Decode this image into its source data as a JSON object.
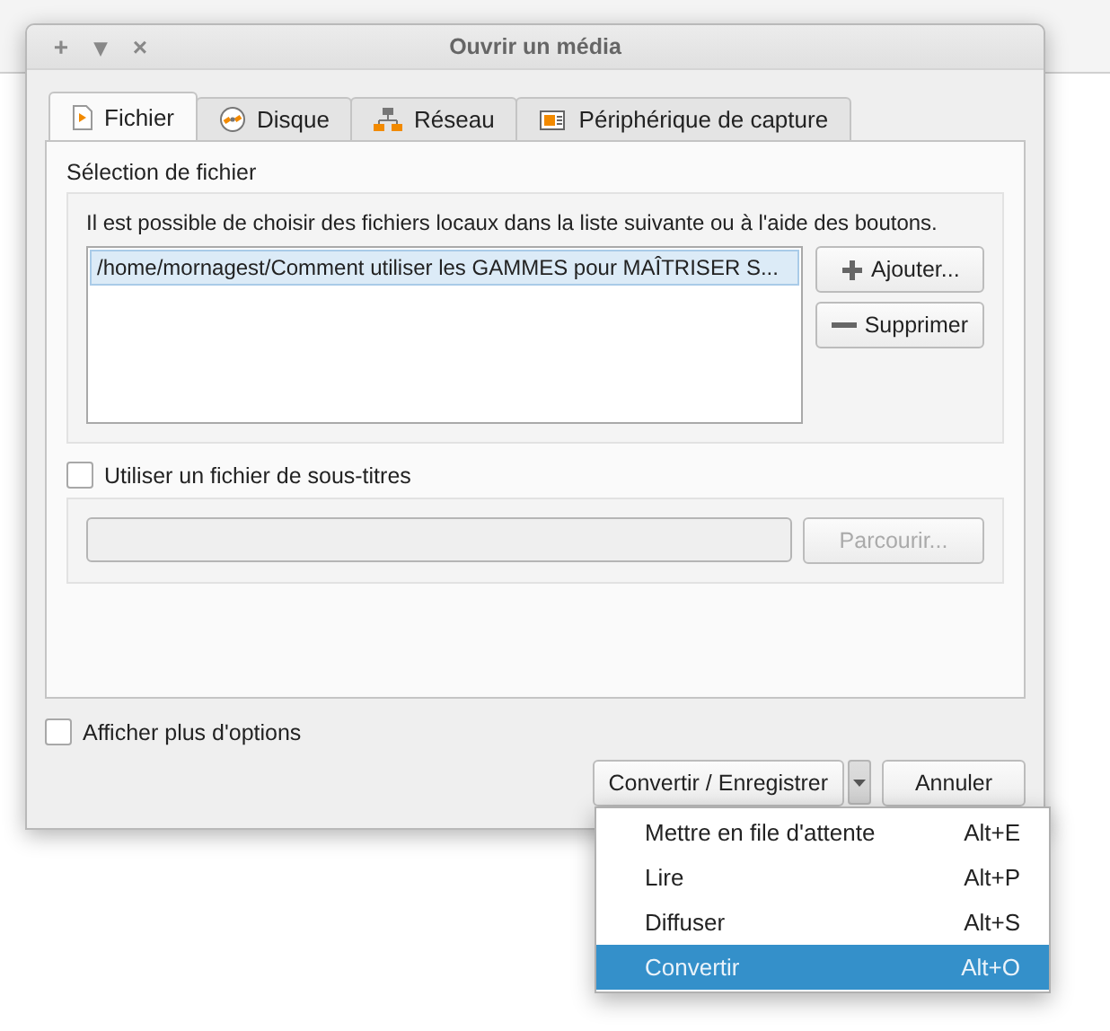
{
  "window": {
    "title": "Ouvrir un média",
    "controls": [
      "+",
      "▾",
      "×"
    ]
  },
  "tabs": [
    {
      "label": "Fichier",
      "kind": "file",
      "selected": true
    },
    {
      "label": "Disque",
      "kind": "disc",
      "selected": false
    },
    {
      "label": "Réseau",
      "kind": "network",
      "selected": false
    },
    {
      "label": "Périphérique de capture",
      "kind": "capture",
      "selected": false
    }
  ],
  "file_selection": {
    "title": "Sélection de fichier",
    "hint": "Il est possible de choisir des fichiers locaux dans la liste suivante ou à l'aide des boutons.",
    "files": [
      {
        "path": "/home/mornagest/Comment utiliser les GAMMES pour MAÎTRISER S...",
        "selected": true
      }
    ],
    "buttons": [
      {
        "label": "Ajouter...",
        "kind": "add"
      },
      {
        "label": "Supprimer",
        "kind": "remove"
      }
    ]
  },
  "subtitles": {
    "label": "Utiliser un fichier de sous-titres",
    "checked": false,
    "browse": {
      "label": "Parcourir...",
      "disabled": true
    }
  },
  "more_options": {
    "label": "Afficher plus d'options",
    "checked": false
  },
  "actions": {
    "primary": "Convertir / Enregistrer",
    "cancel": "Annuler"
  },
  "menu": [
    {
      "label": "Mettre en file d'attente",
      "shortcut": "Alt+E",
      "selected": false
    },
    {
      "label": "Lire",
      "shortcut": "Alt+P",
      "selected": false
    },
    {
      "label": "Diffuser",
      "shortcut": "Alt+S",
      "selected": false
    },
    {
      "label": "Convertir",
      "shortcut": "Alt+O",
      "selected": true
    }
  ]
}
